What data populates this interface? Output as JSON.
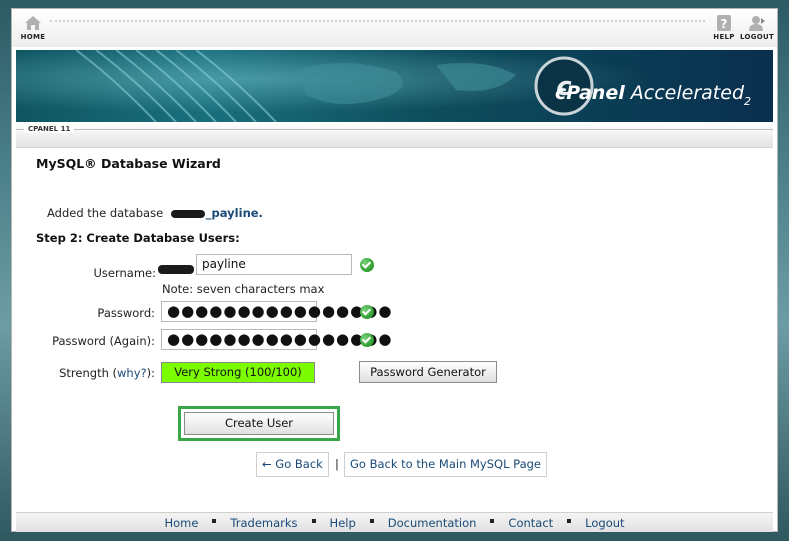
{
  "nav": {
    "home_label": "HOME",
    "help_label": "HELP",
    "logout_label": "LOGOUT"
  },
  "banner": {
    "brand_prefix": "cPanel",
    "brand_name": "Accelerated",
    "brand_version": "2"
  },
  "tabbar": {
    "version": "CPANEL 11"
  },
  "page": {
    "title": "MySQL® Database Wizard",
    "added_prefix": "Added the database",
    "added_db_suffix": "_payline.",
    "step_heading": "Step 2: Create Database Users:"
  },
  "form": {
    "username_label": "Username:",
    "username_value": "payline",
    "note": "Note: seven characters max",
    "password_label": "Password:",
    "password_value": "●●●●●●●●●●●●●●●●",
    "password_again_label": "Password (Again):",
    "password_again_value": "●●●●●●●●●●●●●●●●",
    "strength_label": "Strength (",
    "strength_link": "why?",
    "strength_suffix": "):",
    "strength_value": "Very Strong (100/100)",
    "password_generator": "Password Generator",
    "create_user": "Create User"
  },
  "links": {
    "go_back": "← Go Back",
    "separator": "|",
    "go_back_main": "Go Back to the Main MySQL Page"
  },
  "footer": {
    "items": [
      "Home",
      "Trademarks",
      "Help",
      "Documentation",
      "Contact",
      "Logout"
    ]
  },
  "colors": {
    "strength_bg": "#7cfc00",
    "create_highlight": "#3aa64a",
    "link": "#1a4a78",
    "check": "#2d9a2d"
  }
}
